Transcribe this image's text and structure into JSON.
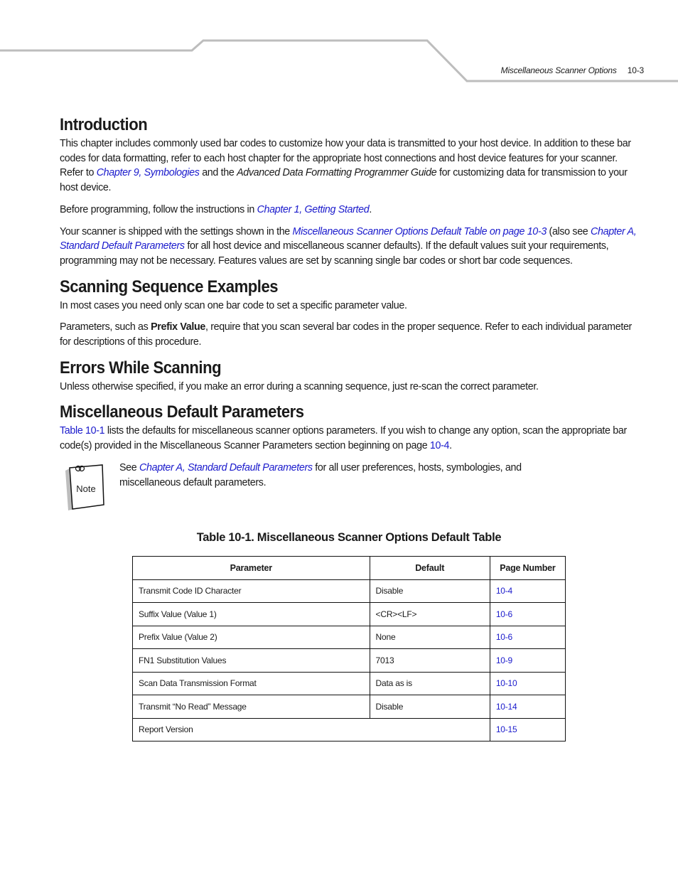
{
  "header": {
    "running_title": "Miscellaneous Scanner Options",
    "page_number": "10-3"
  },
  "sections": {
    "introduction": {
      "heading": "Introduction",
      "p1": {
        "t1": "This chapter includes commonly used bar codes to customize how your data is transmitted to your host device. In addition to these bar codes for data formatting, refer to each host chapter for the appropriate host connections and host device features for your scanner. Refer to ",
        "link1": "Chapter 9, Symbologies",
        "t2": " and the ",
        "em1": "Advanced Data Formatting Programmer Guide",
        "t3": " for customizing data for transmission to your host device."
      },
      "p2": {
        "t1": "Before programming, follow the instructions in ",
        "link1": "Chapter 1, Getting Started",
        "t2": "."
      },
      "p3": {
        "t1": "Your scanner is shipped with the settings shown in the ",
        "link1": "Miscellaneous Scanner Options Default Table on page 10-3",
        "t2": " (also see ",
        "link2": "Chapter A, Standard Default Parameters",
        "t3": " for all host device and miscellaneous scanner defaults). If the default values suit your requirements, programming may not be necessary. Features values are set by scanning single bar codes or short bar code sequences."
      }
    },
    "scanning_sequence": {
      "heading": "Scanning Sequence Examples",
      "p1": "In most cases you need only scan one bar code to set a specific parameter value.",
      "p2": {
        "t1": "Parameters, such as ",
        "bold1": "Prefix Value",
        "t2": ", require that you scan several bar codes in the proper sequence. Refer to each individual parameter for descriptions of this procedure."
      }
    },
    "errors": {
      "heading": "Errors While Scanning",
      "p1": "Unless otherwise specified, if you make an error during a scanning sequence, just re-scan the correct parameter."
    },
    "misc_defaults": {
      "heading": "Miscellaneous Default Parameters",
      "p1": {
        "link1": "Table 10-1",
        "t1": " lists the defaults for miscellaneous scanner options parameters. If you wish to change any option, scan the appropriate bar code(s) provided in the Miscellaneous Scanner Parameters section beginning on page ",
        "link2": "10-4",
        "t2": "."
      },
      "note": {
        "icon_label": "Note",
        "t1": "See ",
        "link1": "Chapter A, Standard Default Parameters",
        "t2": " for all user preferences, hosts, symbologies, and miscellaneous default parameters."
      }
    }
  },
  "table": {
    "caption": "Table 10-1.  Miscellaneous Scanner Options Default Table",
    "headers": [
      "Parameter",
      "Default",
      "Page Number"
    ],
    "rows": [
      {
        "parameter": "Transmit Code ID Character",
        "default": "Disable",
        "page": "10-4"
      },
      {
        "parameter": "Suffix Value (Value 1)",
        "default": "<CR><LF>",
        "page": "10-6"
      },
      {
        "parameter": "Prefix Value (Value 2)",
        "default": "None",
        "page": "10-6"
      },
      {
        "parameter": "FN1 Substitution Values",
        "default": "7013",
        "page": "10-9"
      },
      {
        "parameter": "Scan Data Transmission Format",
        "default": "Data as is",
        "page": "10-10"
      },
      {
        "parameter": "Transmit “No Read” Message",
        "default": "Disable",
        "page": "10-14"
      },
      {
        "parameter": "Report Version",
        "default": "",
        "page": "10-15"
      }
    ]
  },
  "colors": {
    "link": "#1a1acc",
    "header_rule": "#bdbdbd"
  }
}
